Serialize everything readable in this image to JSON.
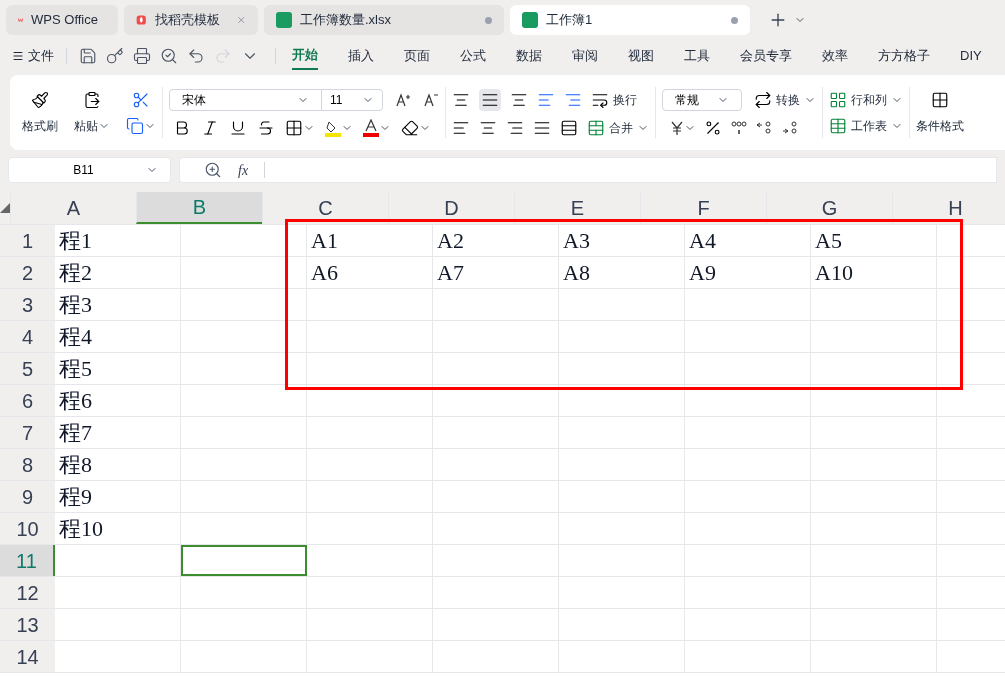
{
  "doc_tabs": [
    {
      "kind": "home",
      "title": "WPS Office",
      "selected": false,
      "closable": false
    },
    {
      "kind": "template",
      "title": "找稻壳模板",
      "selected": false,
      "closable": true
    },
    {
      "kind": "sheet",
      "title": "工作簿数量.xlsx",
      "selected": false,
      "closable": false
    },
    {
      "kind": "sheet",
      "title": "工作簿1",
      "selected": true,
      "closable": false
    }
  ],
  "file_menu": "文件",
  "menu_tabs": [
    {
      "label": "开始",
      "selected": true
    },
    {
      "label": "插入",
      "selected": false
    },
    {
      "label": "页面",
      "selected": false
    },
    {
      "label": "公式",
      "selected": false
    },
    {
      "label": "数据",
      "selected": false
    },
    {
      "label": "审阅",
      "selected": false
    },
    {
      "label": "视图",
      "selected": false
    },
    {
      "label": "工具",
      "selected": false
    },
    {
      "label": "会员专享",
      "selected": false
    },
    {
      "label": "效率",
      "selected": false
    },
    {
      "label": "方方格子",
      "selected": false
    },
    {
      "label": "DIY"
    }
  ],
  "ribbon": {
    "format_painter": "格式刷",
    "paste": "粘贴",
    "font_name": "宋体",
    "font_size": "11",
    "wrap": "换行",
    "merge": "合并",
    "number_format": "常规",
    "convert": "转换",
    "rows_cols": "行和列",
    "worksheet": "工作表",
    "conditional": "条件格式"
  },
  "name_box": "B11",
  "formula": {
    "fx": "fx"
  },
  "columns": [
    {
      "label": "A",
      "selected": false
    },
    {
      "label": "B",
      "selected": true
    },
    {
      "label": "C",
      "selected": false
    },
    {
      "label": "D",
      "selected": false
    },
    {
      "label": "E",
      "selected": false
    },
    {
      "label": "F",
      "selected": false
    },
    {
      "label": "G",
      "selected": false
    },
    {
      "label": "H",
      "selected": false
    }
  ],
  "rows": [
    {
      "number": "1",
      "selected": false,
      "cells": [
        "程1",
        "",
        "A1",
        "A2",
        "A3",
        "A4",
        "A5"
      ]
    },
    {
      "number": "2",
      "selected": false,
      "cells": [
        "程2",
        "",
        "A6",
        "A7",
        "A8",
        "A9",
        "A10"
      ]
    },
    {
      "number": "3",
      "selected": false,
      "cells": [
        "程3"
      ]
    },
    {
      "number": "4",
      "selected": false,
      "cells": [
        "程4"
      ]
    },
    {
      "number": "5",
      "selected": false,
      "cells": [
        "程5"
      ]
    },
    {
      "number": "6",
      "selected": false,
      "cells": [
        "程6"
      ]
    },
    {
      "number": "7",
      "selected": false,
      "cells": [
        "程7"
      ]
    },
    {
      "number": "8",
      "selected": false,
      "cells": [
        "程8"
      ]
    },
    {
      "number": "9",
      "selected": false,
      "cells": [
        "程9"
      ]
    },
    {
      "number": "10",
      "selected": false,
      "cells": [
        "程10"
      ]
    },
    {
      "number": "11",
      "selected": true,
      "cells": []
    },
    {
      "number": "12",
      "selected": false,
      "cells": []
    },
    {
      "number": "13",
      "selected": false,
      "cells": []
    },
    {
      "number": "14",
      "selected": false,
      "cells": []
    }
  ]
}
